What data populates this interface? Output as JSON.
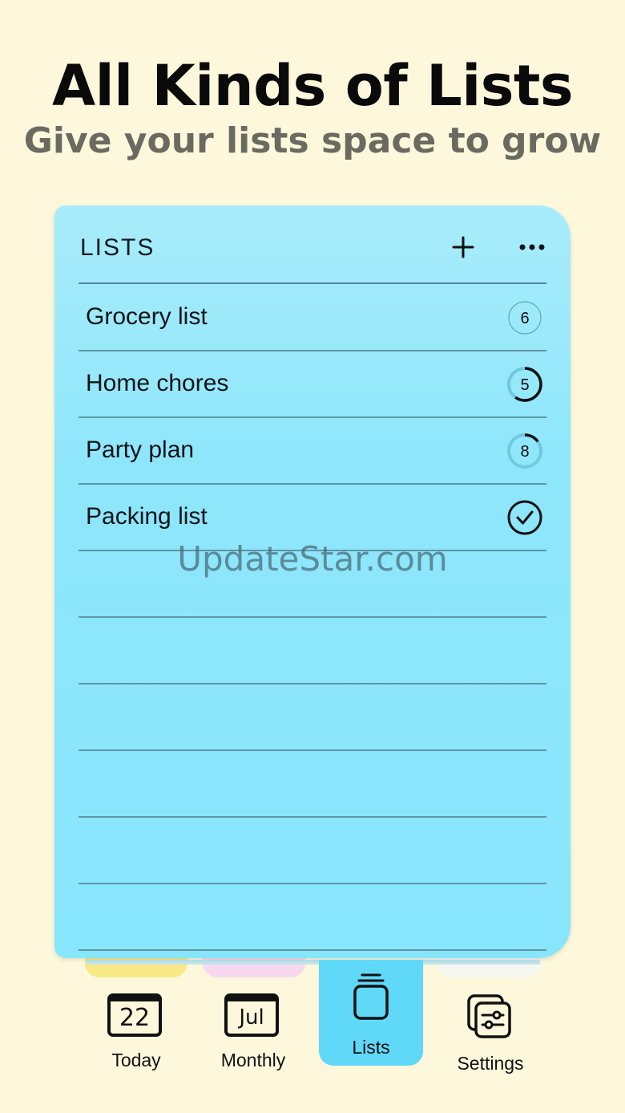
{
  "header": {
    "title": "All Kinds of Lists",
    "subtitle": "Give your lists space to grow"
  },
  "card": {
    "title": "LISTS",
    "add_icon": "plus-icon",
    "more_icon": "ellipsis-icon",
    "lists": [
      {
        "label": "Grocery list",
        "count": "6",
        "progress": 0.0,
        "status": "count"
      },
      {
        "label": "Home chores",
        "count": "5",
        "progress": 0.6,
        "status": "count"
      },
      {
        "label": "Party plan",
        "count": "8",
        "progress": 0.15,
        "status": "count"
      },
      {
        "label": "Packing list",
        "count": "",
        "progress": 1.0,
        "status": "complete"
      }
    ],
    "accent_color": "#8ee6fb"
  },
  "watermark": "UpdateStar.com",
  "tabbar": {
    "tabs": [
      {
        "label": "Today",
        "icon": "calendar-day-icon",
        "icon_text": "22"
      },
      {
        "label": "Monthly",
        "icon": "calendar-month-icon",
        "icon_text": "Jul"
      },
      {
        "label": "Lists",
        "icon": "lists-stack-icon",
        "selected": true
      },
      {
        "label": "Settings",
        "icon": "settings-sliders-icon"
      }
    ],
    "selected_color": "#60d8f8"
  }
}
